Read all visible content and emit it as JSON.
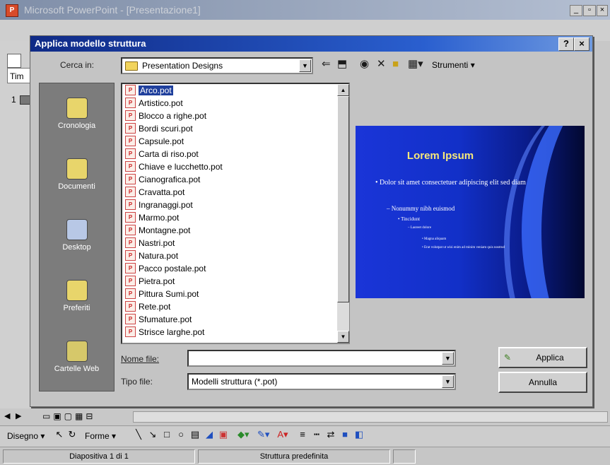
{
  "app": {
    "title": "Microsoft PowerPoint - [Presentazione1]",
    "icon_label": "P",
    "left_tab": "Tim",
    "slide_number": "1"
  },
  "dialog": {
    "title": "Applica modello struttura",
    "help_label": "?",
    "close_label": "×",
    "look_in_label": "Cerca in:",
    "look_in_value": "Presentation Designs",
    "tools_label": "Strumenti",
    "places": [
      "Cronologia",
      "Documenti",
      "Desktop",
      "Preferiti",
      "Cartelle Web"
    ],
    "files": [
      "Arco.pot",
      "Artistico.pot",
      "Blocco a righe.pot",
      "Bordi scuri.pot",
      "Capsule.pot",
      "Carta di riso.pot",
      "Chiave e lucchetto.pot",
      "Cianografica.pot",
      "Cravatta.pot",
      "Ingranaggi.pot",
      "Marmo.pot",
      "Montagne.pot",
      "Nastri.pot",
      "Natura.pot",
      "Pacco postale.pot",
      "Pietra.pot",
      "Pittura Sumi.pot",
      "Rete.pot",
      "Sfumature.pot",
      "Strisce larghe.pot"
    ],
    "selected_file_index": 0,
    "filename_label": "Nome file:",
    "filename_value": "",
    "filetype_label": "Tipo file:",
    "filetype_value": "Modelli struttura (*.pot)",
    "apply_label": "Applica",
    "cancel_label": "Annulla",
    "preview": {
      "title": "Lorem Ipsum",
      "bullet1": "• Dolor sit amet consectetuer adipiscing elit sed diam",
      "bullet2": "– Nonummy nibh euismod",
      "bullet3": "• Tincidunt",
      "bullet4": "– Laoreet dolore",
      "bullet5": "• Magna aliquam",
      "bullet6": "• Erat volutpat ut wisi enim ad minim veniam quis nostrud"
    }
  },
  "toolbar": {
    "draw_label": "Disegno",
    "shapes_label": "Forme"
  },
  "status": {
    "slide_label": "Diapositiva 1 di 1",
    "design_label": "Struttura predefinita"
  },
  "colors": {
    "dialog_title": "#0f2a86",
    "selection": "#1f3f9c",
    "preview_bg": "#1230c8",
    "preview_title": "#f6e87a"
  }
}
